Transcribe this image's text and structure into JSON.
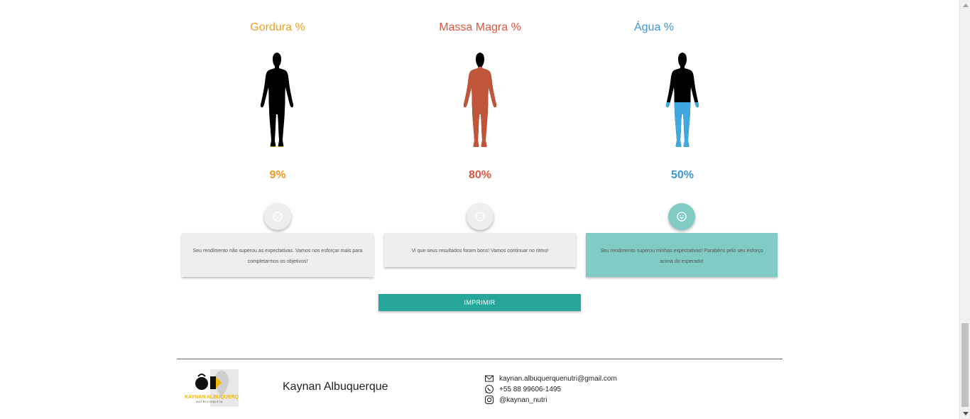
{
  "columns": [
    {
      "title": "Gordura %",
      "value": "9%",
      "title_color": "#e8a02a",
      "value_color": "#ee9a1e",
      "figure_body_color": "#000000",
      "figure_fill_color": "#d4a11a",
      "fill_level": 0.09,
      "fill_region": "feet",
      "smile_icon": "neutral-face-icon",
      "smile_active": false,
      "message": "Seu rendimento não superou as expectativas. Vamos nos esforçar mais para completarmos os objetivos!",
      "card_active": false
    },
    {
      "title": "Massa Magra %",
      "value": "80%",
      "title_color": "#e0553f",
      "value_color": "#e0553f",
      "figure_body_color": "#000000",
      "figure_fill_color": "#c0553a",
      "fill_level": 0.8,
      "fill_region": "below-head",
      "smile_icon": "neutral-face-icon",
      "smile_active": false,
      "message": "Vi que seus resultados foram bons! Vamos continuar no ritmo!",
      "card_active": false
    },
    {
      "title": "Água %",
      "value": "50%",
      "title_color": "#3d95d6",
      "value_color": "#3d95d6",
      "figure_body_color": "#000000",
      "figure_fill_color": "#3fa8e0",
      "fill_level": 0.5,
      "fill_region": "lower-half",
      "smile_icon": "happy-face-icon",
      "smile_active": true,
      "message": "Seu rendimento superou minhas expectativas! Parabéns pelo seu esforço acima do esperado!",
      "card_active": true
    }
  ],
  "print_button": {
    "label": "IMPRIMIR",
    "color": "#26a69a"
  },
  "footer": {
    "logo_text": "KAYNAN ALBUQUERQUE",
    "logo_subtext": "NUTRICIONISTA",
    "name": "Kaynan Albuquerque",
    "contacts": [
      {
        "icon": "envelope-icon",
        "text": "kaynan.albuquerquenutri@gmail.com"
      },
      {
        "icon": "whatsapp-icon",
        "text": "+55 88 99606-1495"
      },
      {
        "icon": "instagram-icon",
        "text": "@kaynan_nutri"
      }
    ]
  },
  "colors": {
    "card_default": "#eeeeee",
    "card_active": "#80cbc4",
    "smile_active_bg": "#80cbc4",
    "smile_default_bg": "#eeeeee"
  }
}
